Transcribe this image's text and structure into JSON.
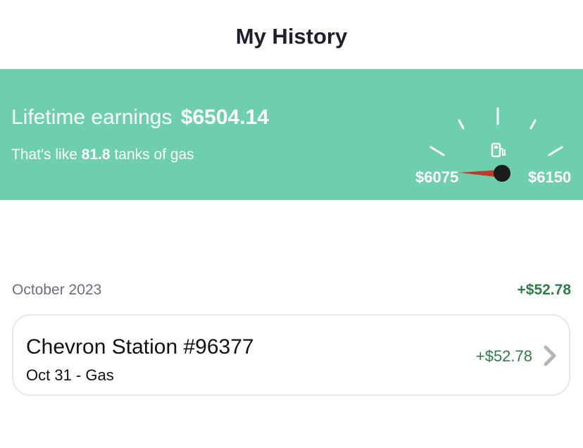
{
  "header": {
    "title": "My History"
  },
  "banner": {
    "background_color": "#6dcfab",
    "earnings_label": "Lifetime earnings",
    "earnings_amount": "$6504.14",
    "tanks_prefix": "That's like",
    "tanks_count": "81.8",
    "tanks_suffix": "tanks of gas",
    "gauge": {
      "min_label": "$6075",
      "max_label": "$6150",
      "icon": "fuel-pump-icon",
      "needle_color": "#c0392b",
      "hub_color": "#1c1c1c"
    }
  },
  "history": {
    "month_label": "October 2023",
    "month_total": "+$52.78",
    "positive_color": "#2e7d45",
    "transactions": [
      {
        "merchant": "Chevron Station #96377",
        "subtitle": "Oct 31 - Gas",
        "amount": "+$52.78",
        "icon": "chevron-right-icon"
      }
    ]
  }
}
